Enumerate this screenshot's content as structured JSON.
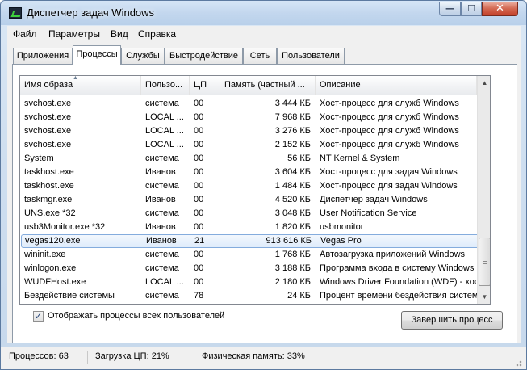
{
  "window": {
    "title": "Диспетчер задач Windows",
    "controls": {
      "minimize": "—",
      "maximize": "☐",
      "close": "✕"
    }
  },
  "menu": [
    "Файл",
    "Параметры",
    "Вид",
    "Справка"
  ],
  "tabs": [
    {
      "label": "Приложения",
      "active": false
    },
    {
      "label": "Процессы",
      "active": true
    },
    {
      "label": "Службы",
      "active": false
    },
    {
      "label": "Быстродействие",
      "active": false
    },
    {
      "label": "Сеть",
      "active": false
    },
    {
      "label": "Пользователи",
      "active": false
    }
  ],
  "columns": [
    "Имя образа",
    "Пользо...",
    "ЦП",
    "Память (частный ...",
    "Описание"
  ],
  "sort_indicator": "▲",
  "rows": [
    {
      "name": "svchost.exe",
      "user": "система",
      "cpu": "00",
      "mem": "3 444 КБ",
      "desc": "Хост-процесс для служб Windows"
    },
    {
      "name": "svchost.exe",
      "user": "LOCAL ...",
      "cpu": "00",
      "mem": "7 968 КБ",
      "desc": "Хост-процесс для служб Windows"
    },
    {
      "name": "svchost.exe",
      "user": "LOCAL ...",
      "cpu": "00",
      "mem": "3 276 КБ",
      "desc": "Хост-процесс для служб Windows"
    },
    {
      "name": "svchost.exe",
      "user": "LOCAL ...",
      "cpu": "00",
      "mem": "2 152 КБ",
      "desc": "Хост-процесс для служб Windows"
    },
    {
      "name": "System",
      "user": "система",
      "cpu": "00",
      "mem": "56 КБ",
      "desc": "NT Kernel & System"
    },
    {
      "name": "taskhost.exe",
      "user": "Иванов",
      "cpu": "00",
      "mem": "3 604 КБ",
      "desc": "Хост-процесс для задач Windows"
    },
    {
      "name": "taskhost.exe",
      "user": "система",
      "cpu": "00",
      "mem": "1 484 КБ",
      "desc": "Хост-процесс для задач Windows"
    },
    {
      "name": "taskmgr.exe",
      "user": "Иванов",
      "cpu": "00",
      "mem": "4 520 КБ",
      "desc": "Диспетчер задач Windows"
    },
    {
      "name": "UNS.exe *32",
      "user": "система",
      "cpu": "00",
      "mem": "3 048 КБ",
      "desc": "User Notification Service"
    },
    {
      "name": "usb3Monitor.exe *32",
      "user": "Иванов",
      "cpu": "00",
      "mem": "1 820 КБ",
      "desc": "usbmonitor"
    },
    {
      "name": "vegas120.exe",
      "user": "Иванов",
      "cpu": "21",
      "mem": "913 616 КБ",
      "desc": "Vegas Pro",
      "selected": true
    },
    {
      "name": "wininit.exe",
      "user": "система",
      "cpu": "00",
      "mem": "1 768 КБ",
      "desc": "Автозагрузка приложений Windows"
    },
    {
      "name": "winlogon.exe",
      "user": "система",
      "cpu": "00",
      "mem": "3 188 КБ",
      "desc": "Программа входа в систему Windows"
    },
    {
      "name": "WUDFHost.exe",
      "user": "LOCAL ...",
      "cpu": "00",
      "mem": "2 180 КБ",
      "desc": "Windows Driver Foundation (WDF) - хос..."
    },
    {
      "name": "Бездействие системы",
      "user": "система",
      "cpu": "78",
      "mem": "24 КБ",
      "desc": "Процент времени бездействия системы"
    }
  ],
  "scrollbar": {
    "up": "▲",
    "down": "▼"
  },
  "show_all_users": {
    "checked": true,
    "check_glyph": "✓",
    "label": "Отображать процессы всех пользователей"
  },
  "end_process_button": "Завершить процесс",
  "status": {
    "processes": "Процессов: 63",
    "cpu": "Загрузка ЦП: 21%",
    "memory": "Физическая память: 33%"
  }
}
